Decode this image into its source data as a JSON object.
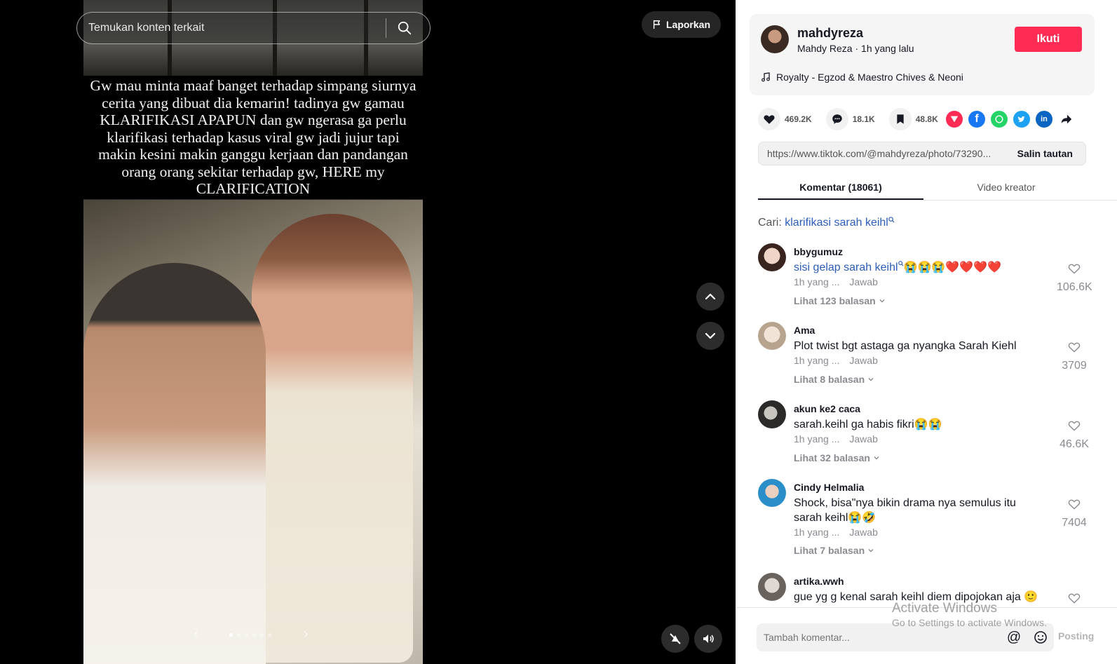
{
  "search": {
    "placeholder": "Temukan konten terkait"
  },
  "report_label": "Laporkan",
  "photo": {
    "caption": "Gw mau minta maaf banget terhadap simpang siurnya cerita yang dibuat dia kemarin! tadinya gw gamau KLARIFIKASI APAPUN dan gw ngerasa ga perlu klarifikasi terhadap kasus viral gw jadi jujur tapi makin kesini makin ganggu kerjaan dan pandangan orang orang sekitar terhadap gw, HERE my CLARIFICATION",
    "prev": "‹",
    "next": "›"
  },
  "author": {
    "username": "mahdyreza",
    "subtitle": "Mahdy Reza · 1h yang lalu",
    "follow_label": "Ikuti",
    "music": "Royalty - Egzod & Maestro Chives & Neoni"
  },
  "stats": {
    "likes": "469.2K",
    "comments": "18.1K",
    "saves": "48.8K"
  },
  "share": {
    "link": "https://www.tiktok.com/@mahdyreza/photo/73290...",
    "copy_label": "Salin tautan"
  },
  "tabs": [
    "Komentar (18061)",
    "Video kreator"
  ],
  "search_suggestion": {
    "prefix": "Cari:",
    "keyword": "klarifikasi sarah keihl"
  },
  "comments": [
    {
      "user": "bbygumuz",
      "text": "sisi gelap sarah keihl",
      "emojis": "😭😭😭❤️❤️❤️❤️",
      "time": "1h yang ...",
      "reply": "Jawab",
      "replies": "Lihat 123 balasan",
      "likes": "106.6K"
    },
    {
      "user": "Ama",
      "text": "Plot twist bgt astaga ga nyangka Sarah Kiehl",
      "emojis": "",
      "time": "1h yang ...",
      "reply": "Jawab",
      "replies": "Lihat 8 balasan",
      "likes": "3709"
    },
    {
      "user": "akun ke2 caca",
      "text": "sarah.keihl ga habis fikri",
      "emojis": "😭😭",
      "time": "1h yang ...",
      "reply": "Jawab",
      "replies": "Lihat 32 balasan",
      "likes": "46.6K"
    },
    {
      "user": "Cindy Helmalia",
      "text": "Shock, bisa\"nya bikin drama nya semulus itu sarah keihl",
      "emojis": "😭🤣",
      "time": "1h yang ...",
      "reply": "Jawab",
      "replies": "Lihat 7 balasan",
      "likes": "7404"
    },
    {
      "user": "artika.wwh",
      "text": "gue yg g kenal sarah keihl diem dipojokan aja",
      "emojis": "🙂",
      "time": "",
      "reply": "",
      "replies": "",
      "likes": ""
    }
  ],
  "comment_input": {
    "placeholder": "Tambah komentar...",
    "post_label": "Posting"
  },
  "watermark": {
    "title": "Activate Windows",
    "subtitle": "Go to Settings to activate Windows."
  },
  "colors": {
    "accent": "#fe2c55",
    "link": "#2b5db9"
  },
  "icons": {
    "heart": "heart-icon",
    "comment": "comment-icon",
    "bookmark": "bookmark-icon",
    "share": "share-arrow-icon"
  }
}
